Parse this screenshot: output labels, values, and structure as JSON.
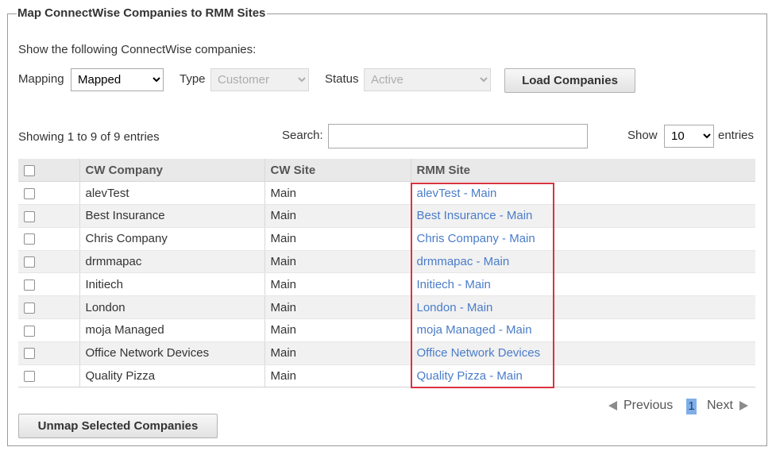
{
  "panel": {
    "title": "Map ConnectWise Companies to RMM Sites",
    "intro": "Show the following ConnectWise companies:"
  },
  "filters": {
    "mapping_label": "Mapping",
    "mapping_value": "Mapped",
    "type_label": "Type",
    "type_value": "Customer",
    "status_label": "Status",
    "status_value": "Active",
    "load_button": "Load Companies"
  },
  "table_controls": {
    "info": "Showing 1 to 9 of 9 entries",
    "search_label": "Search:",
    "search_value": "",
    "show_label": "Show",
    "page_size": "10",
    "entries_label": "entries"
  },
  "table": {
    "headers": [
      "CW Company",
      "CW Site",
      "RMM Site"
    ],
    "rows": [
      {
        "company": "alevTest",
        "site": "Main",
        "rmm": "alevTest - Main"
      },
      {
        "company": "Best Insurance",
        "site": "Main",
        "rmm": "Best Insurance - Main"
      },
      {
        "company": "Chris Company",
        "site": "Main",
        "rmm": "Chris Company - Main"
      },
      {
        "company": "drmmapac",
        "site": "Main",
        "rmm": "drmmapac - Main"
      },
      {
        "company": "Initiech",
        "site": "Main",
        "rmm": "Initiech - Main"
      },
      {
        "company": "London",
        "site": "Main",
        "rmm": "London - Main"
      },
      {
        "company": "moja Managed",
        "site": "Main",
        "rmm": "moja Managed - Main"
      },
      {
        "company": "Office Network Devices",
        "site": "Main",
        "rmm": "Office Network Devices"
      },
      {
        "company": "Quality Pizza",
        "site": "Main",
        "rmm": "Quality Pizza - Main"
      }
    ]
  },
  "pagination": {
    "previous": "Previous",
    "current_page": "1",
    "next": "Next"
  },
  "actions": {
    "unmap_button": "Unmap Selected Companies"
  },
  "colors": {
    "link": "#4a7cc9",
    "highlight_border": "#d9333f",
    "current_page_bg": "#7faee8"
  },
  "icons": {
    "previous": "triangle-left-icon",
    "next": "triangle-right-icon"
  }
}
